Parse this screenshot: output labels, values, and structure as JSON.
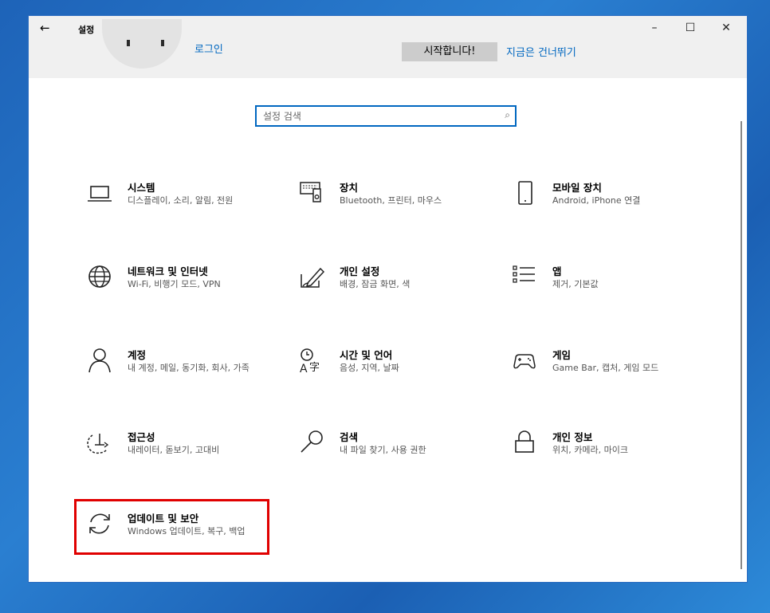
{
  "window": {
    "title": "설정",
    "back": "←",
    "minimize": "–",
    "maximize": "☐",
    "close": "✕"
  },
  "account": {
    "login": "로그인",
    "start_button": "시작합니다!",
    "skip": "지금은 건너뛰기"
  },
  "search": {
    "placeholder": "설정 검색",
    "icon": "⌕"
  },
  "tiles": [
    {
      "title": "시스템",
      "subtitle": "디스플레이, 소리, 알림, 전원",
      "icon": "laptop-icon"
    },
    {
      "title": "장치",
      "subtitle": "Bluetooth, 프린터, 마우스",
      "icon": "keyboard-icon"
    },
    {
      "title": "모바일 장치",
      "subtitle": "Android, iPhone 연결",
      "icon": "phone-icon"
    },
    {
      "title": "네트워크 및 인터넷",
      "subtitle": "Wi-Fi, 비행기 모드, VPN",
      "icon": "globe-icon"
    },
    {
      "title": "개인 설정",
      "subtitle": "배경, 잠금 화면, 색",
      "icon": "pen-icon"
    },
    {
      "title": "앱",
      "subtitle": "제거, 기본값",
      "icon": "apps-list-icon"
    },
    {
      "title": "계정",
      "subtitle": "내 계정, 메일, 동기화, 회사, 가족",
      "icon": "person-icon"
    },
    {
      "title": "시간 및 언어",
      "subtitle": "음성, 지역, 날짜",
      "icon": "time-language-icon"
    },
    {
      "title": "게임",
      "subtitle": "Game Bar, 캡처, 게임 모드",
      "icon": "gamepad-icon"
    },
    {
      "title": "접근성",
      "subtitle": "내레이터, 돋보기, 고대비",
      "icon": "accessibility-icon"
    },
    {
      "title": "검색",
      "subtitle": "내 파일 찾기, 사용 권한",
      "icon": "search-icon"
    },
    {
      "title": "개인 정보",
      "subtitle": "위치, 카메라, 마이크",
      "icon": "lock-icon"
    },
    {
      "title": "업데이트 및 보안",
      "subtitle": "Windows 업데이트, 복구, 백업",
      "icon": "update-icon"
    }
  ],
  "colors": {
    "accent": "#0067c0",
    "highlight": "#e00000",
    "titlebar": "#f0f0f0"
  }
}
